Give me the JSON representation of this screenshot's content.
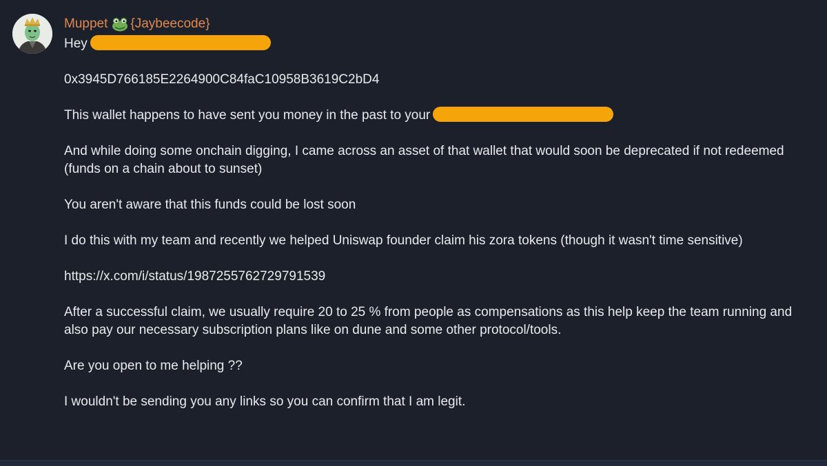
{
  "message": {
    "sender_name": "Muppet",
    "sender_handle": "{Jaybeecode}",
    "sender_icon": "frog-icon",
    "colors": {
      "background": "#1b202a",
      "sender_name": "#e0884f",
      "text": "#e8eaee",
      "redaction": "#f5a50a"
    },
    "greeting": "Hey",
    "wallet_address": "0x3945D766185E2264900C84faC10958B3619C2bD4",
    "line_wallet_sent": "This wallet happens to have sent you money in the past  to your",
    "para_digging": "And while doing some onchain digging, I came across an asset of that wallet  that would soon be deprecated if not redeemed (funds on a chain about to sunset)",
    "para_unaware": "You aren't  aware that this funds could be lost soon",
    "para_team": "I do this with my team and recently we helped Uniswap founder claim his zora tokens (though it wasn't time sensitive)",
    "link": "https://x.com/i/status/1987255762729791539",
    "para_compensation": "After a successful claim, we usually require 20 to 25 % from people as compensations as this help keep the team running and also pay our necessary subscription plans like on dune and some other protocol/tools.",
    "question": "Are you open to me helping ??",
    "closing": "I wouldn't be sending you any links  so you can confirm that I am legit."
  }
}
